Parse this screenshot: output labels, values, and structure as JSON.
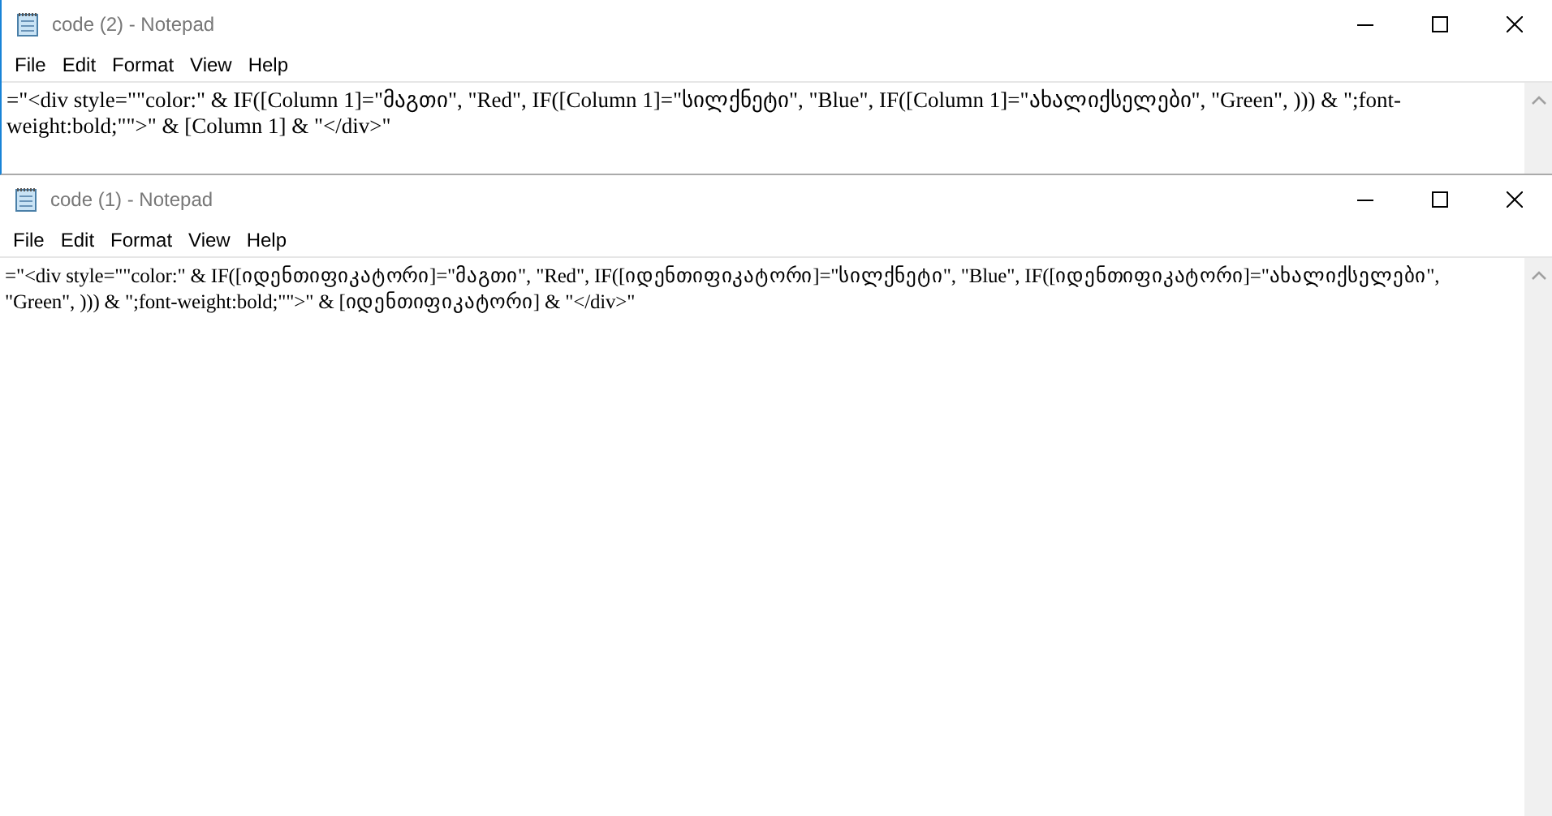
{
  "windows": [
    {
      "title": "code (2) - Notepad",
      "menu": [
        "File",
        "Edit",
        "Format",
        "View",
        "Help"
      ],
      "lines": [
        "=\"<div style=\"\"color:\" & IF([Column 1]=\"მაგთი\", \"Red\", IF([Column 1]=\"სილქნეტი\", \"Blue\", IF([Column 1]=\"ახალიქსელები\", \"Green\", ))) & \";font-",
        "weight:bold;\"\">\" & [Column 1] & \"</div>\""
      ]
    },
    {
      "title": "code (1) - Notepad",
      "menu": [
        "File",
        "Edit",
        "Format",
        "View",
        "Help"
      ],
      "lines": [
        "=\"<div style=\"\"color:\" & IF([იდენთიფიკატორი]=\"მაგთი\", \"Red\", IF([იდენთიფიკატორი]=\"სილქნეტი\", \"Blue\", IF([იდენთიფიკატორი]=\"ახალიქსელები\",",
        "\"Green\", ))) & \";font-weight:bold;\"\">\" & [იდენთიფიკატორი] & \"</div>\""
      ]
    }
  ]
}
